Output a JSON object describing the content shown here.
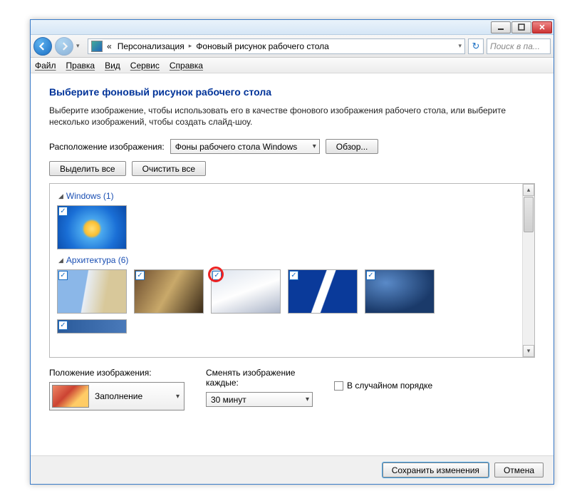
{
  "breadcrumb": {
    "parent": "Персонализация",
    "current": "Фоновый рисунок рабочего стола",
    "prefix": "«"
  },
  "search": {
    "placeholder": "Поиск в па..."
  },
  "menu": {
    "file": "Файл",
    "edit": "Правка",
    "view": "Вид",
    "tools": "Сервис",
    "help": "Справка"
  },
  "heading": "Выберите фоновый рисунок рабочего стола",
  "description": "Выберите изображение, чтобы использовать его в качестве фонового изображения рабочего стола, или выберите несколько изображений, чтобы создать слайд-шоу.",
  "location": {
    "label": "Расположение изображения:",
    "value": "Фоны рабочего стола Windows",
    "browse": "Обзор..."
  },
  "selbtns": {
    "selectAll": "Выделить все",
    "clearAll": "Очистить все"
  },
  "groups": [
    {
      "name": "Windows",
      "count": 1,
      "items": [
        {
          "cls": "wp-win",
          "checked": true
        }
      ]
    },
    {
      "name": "Архитектура",
      "count": 6,
      "items": [
        {
          "cls": "wp-a1",
          "checked": true
        },
        {
          "cls": "wp-a2",
          "checked": true
        },
        {
          "cls": "wp-a3",
          "checked": true,
          "highlight": true
        },
        {
          "cls": "wp-a4",
          "checked": true
        },
        {
          "cls": "wp-a5",
          "checked": true
        }
      ],
      "overflow": [
        {
          "cls": "wp-a6",
          "checked": true
        }
      ]
    }
  ],
  "position": {
    "label": "Положение изображения:",
    "value": "Заполнение"
  },
  "change": {
    "label": "Сменять изображение каждые:",
    "value": "30 минут"
  },
  "shuffle": {
    "label": "В случайном порядке"
  },
  "footer": {
    "save": "Сохранить изменения",
    "cancel": "Отмена"
  }
}
